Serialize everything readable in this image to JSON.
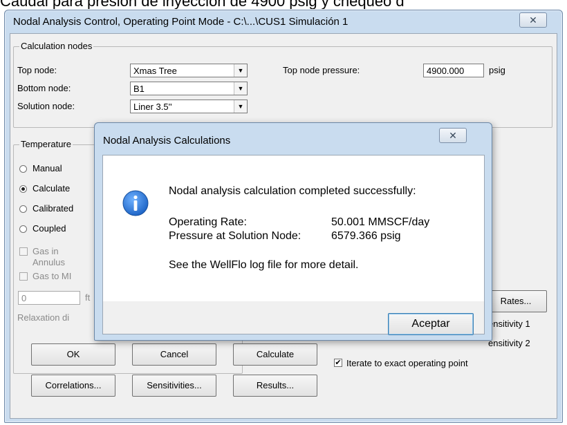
{
  "background_text": "Caudal para presión de inyección de 4900 psig y chequeo d",
  "main": {
    "title": "Nodal Analysis Control, Operating Point Mode - C:\\...\\CUS1 Simulación 1",
    "close_glyph": "✕",
    "calc_nodes": {
      "group_label": "Calculation nodes",
      "top_node_label": "Top node:",
      "top_node_value": "Xmas Tree",
      "bottom_node_label": "Bottom node:",
      "bottom_node_value": "B1",
      "solution_node_label": "Solution node:",
      "solution_node_value": "Liner 3.5''",
      "top_node_pressure_label": "Top node pressure:",
      "top_node_pressure_value": "4900.000",
      "pressure_unit": "psig"
    },
    "temperature": {
      "group_label": "Temperature",
      "options": [
        {
          "label": "Manual",
          "checked": false
        },
        {
          "label": "Calculate",
          "checked": true
        },
        {
          "label": "Calibrated",
          "checked": false
        },
        {
          "label": "Coupled",
          "checked": false
        }
      ],
      "gas_in_annulus_line1": "Gas in",
      "gas_in_annulus_line2": "Annulus",
      "gas_to_mi": "Gas to MI",
      "numeric_value": "0",
      "numeric_unit": "ft",
      "relaxation_label": "Relaxation di"
    },
    "right": {
      "rates_button": "Rates...",
      "sensitivity1": "ensitivity 1",
      "sensitivity2": "ensitivity 2",
      "iterate_label": "Iterate to exact operating point",
      "iterate_checked": "✔"
    },
    "buttons": {
      "ok": "OK",
      "cancel": "Cancel",
      "calculate": "Calculate",
      "correlations": "Correlations...",
      "sensitivities": "Sensitivities...",
      "results": "Results..."
    }
  },
  "dialog": {
    "title": "Nodal Analysis Calculations",
    "close_glyph": "✕",
    "message": "Nodal analysis calculation completed successfully:",
    "operating_rate_label": "Operating Rate:",
    "operating_rate_value": "50.001 MMSCF/day",
    "pressure_label": "Pressure at Solution Node:",
    "pressure_value": "6579.366 psig",
    "log_note": "See the WellFlo log file for more detail.",
    "accept_button": "Aceptar"
  },
  "colors": {
    "frame": "#c9dcef",
    "client": "#f0f0f0",
    "info_icon": "#1f66c7"
  }
}
